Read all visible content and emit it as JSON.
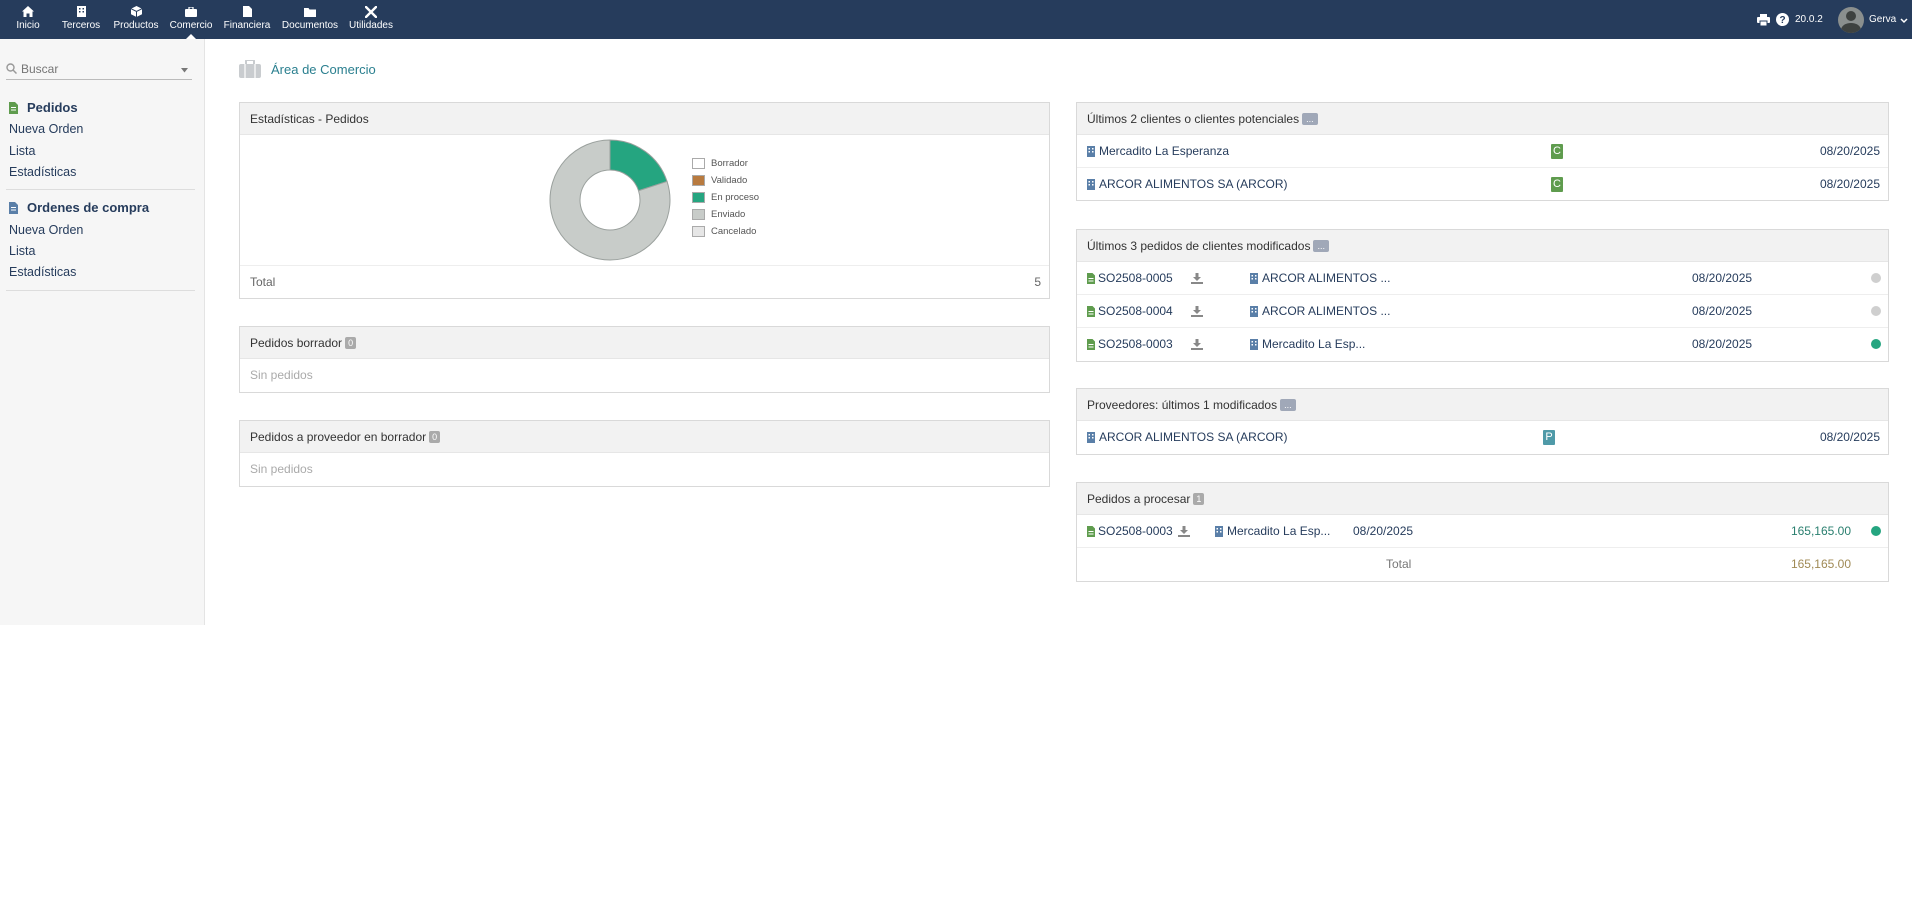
{
  "nav": {
    "items": [
      {
        "label": "Inicio",
        "icon": "home-icon"
      },
      {
        "label": "Terceros",
        "icon": "building-icon"
      },
      {
        "label": "Productos",
        "icon": "cube-icon"
      },
      {
        "label": "Comercio",
        "icon": "briefcase-icon"
      },
      {
        "label": "Financiera",
        "icon": "file-icon"
      },
      {
        "label": "Documentos",
        "icon": "folder-icon"
      },
      {
        "label": "Utilidades",
        "icon": "tools-icon"
      }
    ],
    "active": "Comercio",
    "version": "20.0.2",
    "user": "Gerva"
  },
  "sidebar": {
    "search_placeholder": "Buscar",
    "sections": [
      {
        "title": "Pedidos",
        "links": [
          "Nueva Orden",
          "Lista",
          "Estadísticas"
        ]
      },
      {
        "title": "Ordenes de compra",
        "links": [
          "Nueva Orden",
          "Lista",
          "Estadísticas"
        ]
      }
    ]
  },
  "page": {
    "title": "Área de Comercio"
  },
  "stats": {
    "title": "Estadísticas - Pedidos",
    "total_label": "Total",
    "total_value": "5"
  },
  "chart_data": {
    "type": "pie",
    "categories": [
      "Borrador",
      "Validado",
      "En proceso",
      "Enviado",
      "Cancelado"
    ],
    "values": [
      0,
      0,
      1,
      4,
      0
    ],
    "colors": [
      "#ffffff",
      "#b87a3f",
      "#25a580",
      "#c8ccc9",
      "#e6e6e6"
    ],
    "legend": "right"
  },
  "drafts": {
    "title": "Pedidos borrador",
    "count": "0",
    "empty": "Sin pedidos"
  },
  "supplier_drafts": {
    "title": "Pedidos a proveedor en borrador",
    "count": "0",
    "empty": "Sin pedidos"
  },
  "last_clients": {
    "title": "Últimos 2 clientes o clientes potenciales",
    "more": "...",
    "rows": [
      {
        "name": "Mercadito La Esperanza",
        "tag": "C",
        "date": "08/20/2025"
      },
      {
        "name": "ARCOR ALIMENTOS SA (ARCOR)",
        "tag": "C",
        "date": "08/20/2025"
      }
    ]
  },
  "last_orders": {
    "title": "Últimos 3 pedidos de clientes modificados",
    "more": "...",
    "rows": [
      {
        "ref": "SO2508-0005",
        "client": "ARCOR ALIMENTOS ...",
        "date": "08/20/2025",
        "status_color": "#cfcfcf"
      },
      {
        "ref": "SO2508-0004",
        "client": "ARCOR ALIMENTOS ...",
        "date": "08/20/2025",
        "status_color": "#cfcfcf"
      },
      {
        "ref": "SO2508-0003",
        "client": "Mercadito La Esp...",
        "date": "08/20/2025",
        "status_color": "#25a580"
      }
    ]
  },
  "suppliers": {
    "title": "Proveedores: últimos 1 modificados",
    "more": "...",
    "rows": [
      {
        "name": "ARCOR ALIMENTOS SA (ARCOR)",
        "tag": "P",
        "date": "08/20/2025"
      }
    ]
  },
  "to_process": {
    "title": "Pedidos a procesar",
    "count": "1",
    "rows": [
      {
        "ref": "SO2508-0003",
        "client": "Mercadito La Esp...",
        "date": "08/20/2025",
        "amount": "165,165.00",
        "status_color": "#25a580"
      }
    ],
    "total_label": "Total",
    "total_value": "165,165.00"
  }
}
